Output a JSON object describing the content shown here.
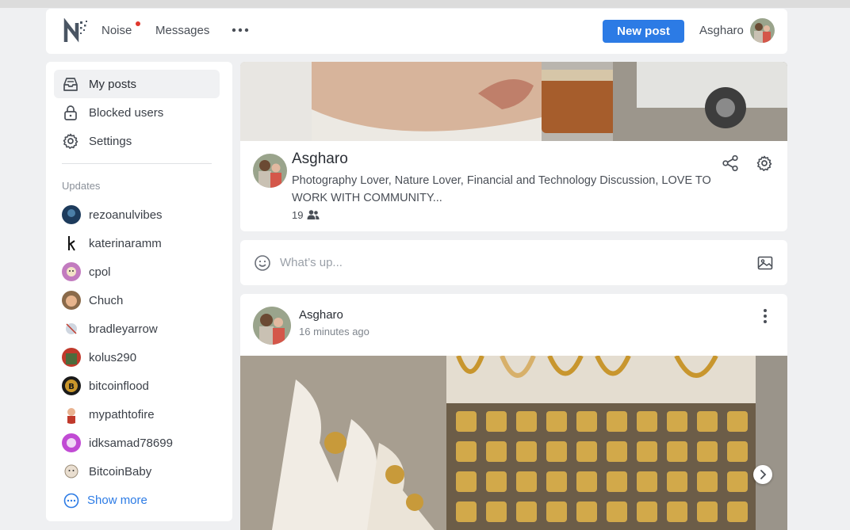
{
  "header": {
    "nav": {
      "noise": "Noise",
      "messages": "Messages"
    },
    "new_post_label": "New post",
    "user_name": "Asgharo",
    "brand_color": "#2c7be5",
    "notification_dot_color": "#e0372d"
  },
  "sidebar": {
    "menu": {
      "my_posts": "My posts",
      "blocked_users": "Blocked users",
      "settings": "Settings"
    },
    "updates_title": "Updates",
    "updates": [
      {
        "name": "rezoanulvibes",
        "color": "#1d3b5c"
      },
      {
        "name": "katerinaramm",
        "color": "#ffffff"
      },
      {
        "name": "cpol",
        "color": "#c27bbf"
      },
      {
        "name": "Chuch",
        "color": "#8a6a4a"
      },
      {
        "name": "bradleyarrow",
        "color": "#cfd6e0"
      },
      {
        "name": "kolus290",
        "color": "#4c6b3c"
      },
      {
        "name": "bitcoinflood",
        "color": "#1a1a1a"
      },
      {
        "name": "mypathtofire",
        "color": "#f1e3d3"
      },
      {
        "name": "idksamad78699",
        "color": "#c14bd4"
      },
      {
        "name": "BitcoinBaby",
        "color": "#e9ded0"
      }
    ],
    "show_more": "Show more"
  },
  "profile": {
    "name": "Asgharo",
    "bio": "Photography Lover, Nature Lover, Financial and Technology Discussion, LOVE TO WORK WITH COMMUNITY...",
    "followers": "19"
  },
  "composer": {
    "placeholder": "What’s up..."
  },
  "post": {
    "author": "Asgharo",
    "time": "16 minutes ago"
  },
  "icons": {
    "logo": "noise-logo",
    "more": "more-horizontal-icon",
    "my_posts": "inbox-icon",
    "blocked": "lock-icon",
    "settings": "gear-icon",
    "show_more": "more-circle-icon",
    "share": "share-icon",
    "profile_settings": "gear-icon",
    "composer_emoji": "smile-icon",
    "composer_image": "image-icon",
    "post_menu": "more-vertical-icon",
    "carousel_next": "chevron-right-icon"
  }
}
